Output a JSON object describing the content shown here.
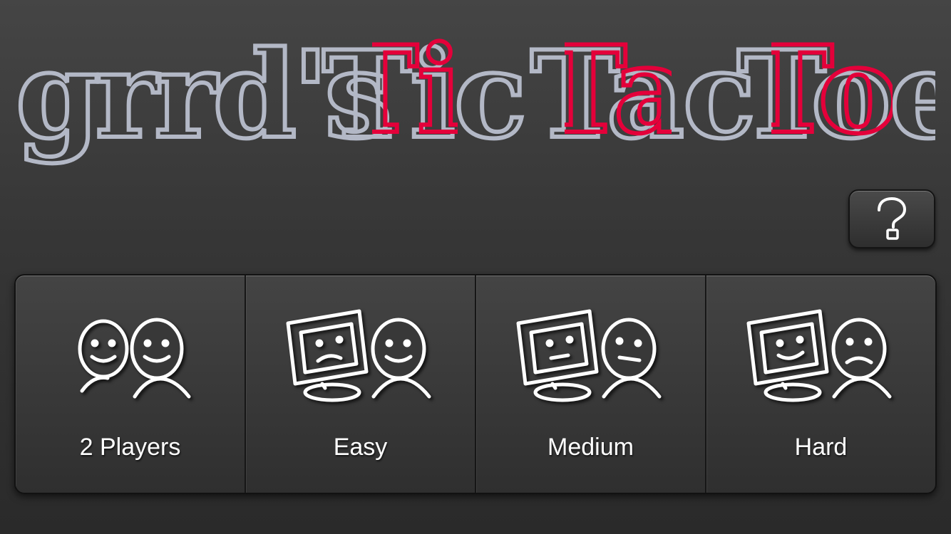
{
  "logo": {
    "prefix": "grrd's",
    "words": [
      "Tic",
      "Tac",
      "Toe"
    ]
  },
  "colors": {
    "gray": "#b3b8c6",
    "red": "#e4003a",
    "background": "#3a3a3a",
    "icon": "#ffffff"
  },
  "help": {
    "icon": "question-mark-icon"
  },
  "modes": [
    {
      "label": "2 Players",
      "icon": "two-players-icon"
    },
    {
      "label": "Easy",
      "icon": "computer-easy-icon"
    },
    {
      "label": "Medium",
      "icon": "computer-medium-icon"
    },
    {
      "label": "Hard",
      "icon": "computer-hard-icon"
    }
  ]
}
